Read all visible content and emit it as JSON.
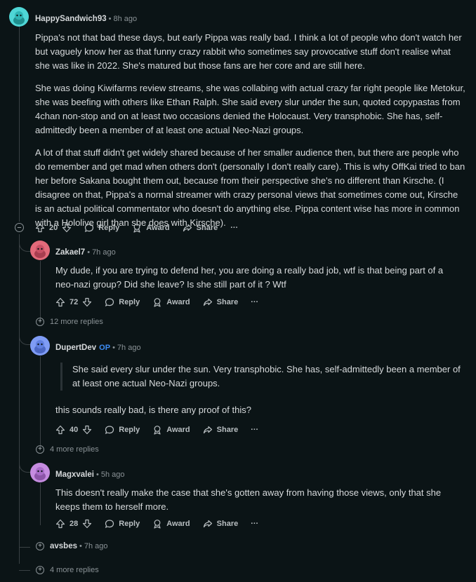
{
  "comments": {
    "c1": {
      "user": "HappySandwich93",
      "time": "8h ago",
      "paragraphs": [
        "Pippa's not that bad these days, but early Pippa was really bad. I think a lot of people who don't watch her but vaguely know her as that funny crazy rabbit who sometimes say provocative stuff don't realise what she was like in 2022. She's matured but those fans are her core and are still here.",
        "She was doing Kiwifarms review streams, she was collabing with actual crazy far right people like Metokur, she was beefing with others like Ethan Ralph. She said every slur under the sun, quoted copypastas from 4chan non-stop and on at least two occasions denied the Holocaust. Very transphobic. She has, self-admittedly been a member of at least one actual Neo-Nazi groups.",
        "A lot of that stuff didn't get widely shared because of her smaller audience then, but there are people who do remember and get mad when others don't (personally I don't really care). This is why OffKai tried to ban her before Sakana bought them out, because from their perspective she's no different than Kirsche. (I disagree on that, Pippa's a normal streamer with crazy personal views that sometimes come out, Kirsche is an actual political commentator who doesn't do anything else. Pippa content wise has more in common with a Hololive girl than she does with Kirsche)."
      ],
      "votes": "20",
      "avatar_color": "#4fd6d6"
    },
    "c2": {
      "user": "Zakael7",
      "time": "7h ago",
      "text": "My dude, if you are trying to defend her, you are doing a really bad job, wtf is that being part of a neo-nazi group? Did she leave? Is she still part of it ? Wtf",
      "votes": "72",
      "more_replies": "12 more replies",
      "avatar_color": "#e26a7a"
    },
    "c3": {
      "user": "DupertDev",
      "op_badge": "OP",
      "time": "7h ago",
      "quote": "She said every slur under the sun. Very transphobic. She has, self-admittedly been a member of at least one actual Neo-Nazi groups.",
      "text": "this sounds really bad, is there any proof of this?",
      "votes": "40",
      "more_replies": "4 more replies",
      "avatar_color": "#7f9cf5"
    },
    "c4": {
      "user": "Magxvalei",
      "time": "5h ago",
      "text": "This doesn't really make the case that she's gotten away from having those views, only that she keeps them to herself more.",
      "votes": "28",
      "avatar_color": "#c58ce0"
    },
    "c5": {
      "user": "avsbes",
      "time": "7h ago"
    }
  },
  "actions": {
    "reply": "Reply",
    "award": "Award",
    "share": "Share",
    "more": "···"
  },
  "bottom_more_replies": "4 more replies"
}
